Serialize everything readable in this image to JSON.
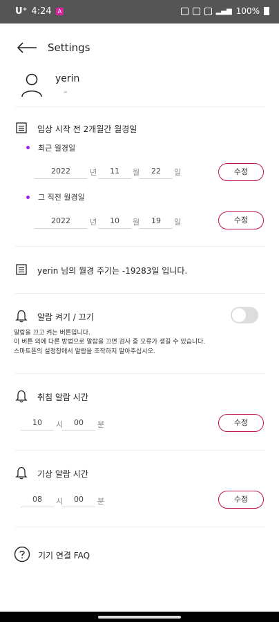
{
  "status": {
    "carrier": "U⁺",
    "time": "4:24",
    "badge": "A",
    "battery": "100%"
  },
  "header": {
    "title": "Settings"
  },
  "profile": {
    "name": "yerin",
    "sub": "–"
  },
  "period": {
    "title": "임상 시작 전 2개월간 월경일",
    "recent_label": "최근 월경일",
    "recent": {
      "year": "2022",
      "month": "11",
      "day": "22"
    },
    "previous_label": "그 직전 월경일",
    "previous": {
      "year": "2022",
      "month": "10",
      "day": "19"
    },
    "unit_year": "년",
    "unit_month": "월",
    "unit_day": "일",
    "edit_label": "수정"
  },
  "cycle": {
    "text": "yerin 님의 월경 주기는 -19283일 입니다."
  },
  "alarm": {
    "title": "알람 켜기 / 끄기",
    "enabled": false,
    "desc1": "알람을 끄고 켜는 버튼입니다.",
    "desc2": "이 버튼 외에 다른 방법으로 알람을 끄면 검사 중 오류가 생길 수 있습니다.",
    "desc3": "스마트폰의 설정창에서 알람을 조작하지 말아주십시오."
  },
  "sleep_alarm": {
    "title": "취침 알람 시간",
    "hour": "10",
    "minute": "00",
    "unit_hour": "시",
    "unit_minute": "분",
    "edit_label": "수정"
  },
  "wake_alarm": {
    "title": "기상 알람 시간",
    "hour": "08",
    "minute": "00",
    "unit_hour": "시",
    "unit_minute": "분",
    "edit_label": "수정"
  },
  "faq": {
    "label": "기기 연결 FAQ"
  }
}
